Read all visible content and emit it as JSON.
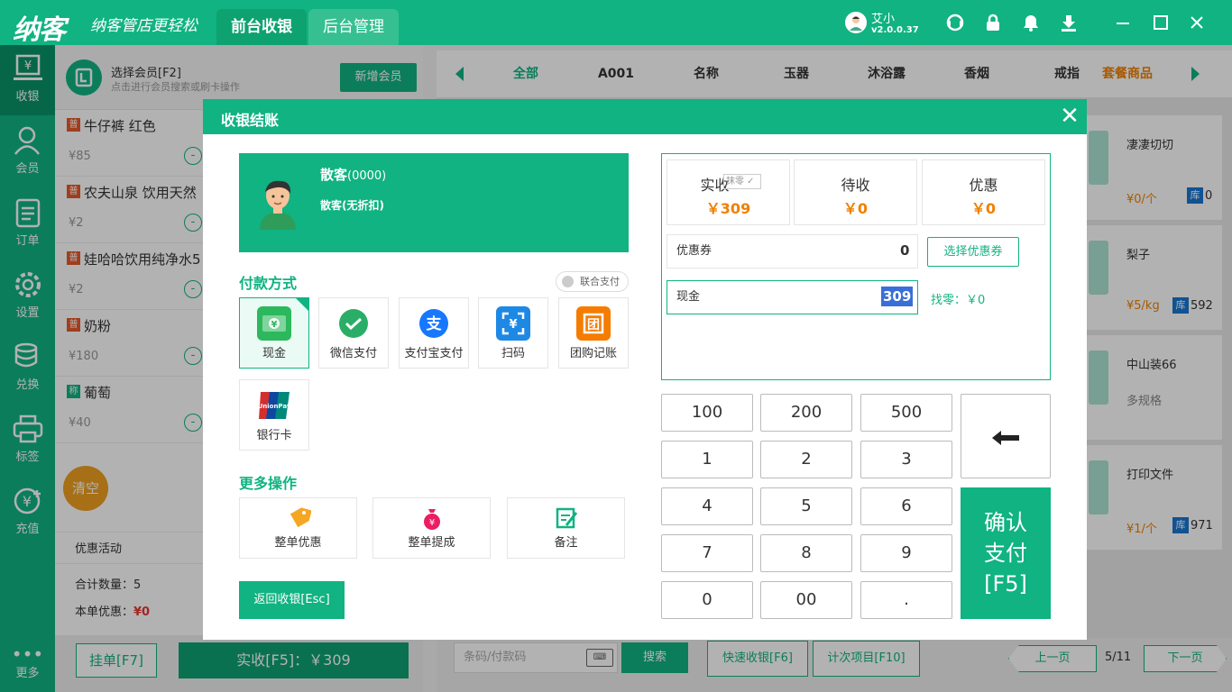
{
  "app": {
    "logo": "纳客",
    "slogan": "纳客管店更轻松",
    "tabs": [
      {
        "label": "前台收银"
      },
      {
        "label": "后台管理"
      }
    ],
    "user": {
      "name": "艾小",
      "version": "v2.0.0.37"
    }
  },
  "sidebar": {
    "items": [
      {
        "label": "收银",
        "icon": "cashier-icon"
      },
      {
        "label": "会员",
        "icon": "member-icon"
      },
      {
        "label": "订单",
        "icon": "order-icon"
      },
      {
        "label": "设置",
        "icon": "gear-icon"
      },
      {
        "label": "兑换",
        "icon": "exchange-icon"
      },
      {
        "label": "标签",
        "icon": "printer-icon"
      },
      {
        "label": "充值",
        "icon": "recharge-icon"
      },
      {
        "label": "更多",
        "icon": "more-icon"
      }
    ]
  },
  "member": {
    "title": "选择会员[F2]",
    "subtitle": "点击进行会员搜索或刷卡操作",
    "add_label": "新增会员"
  },
  "cart": {
    "items": [
      {
        "tag": "普",
        "name": "牛仔裤 红色",
        "price": "¥85"
      },
      {
        "tag": "普",
        "name": "农夫山泉 饮用天然",
        "price": "¥2"
      },
      {
        "tag": "普",
        "name": "娃哈哈饮用纯净水5",
        "price": "¥2"
      },
      {
        "tag": "普",
        "name": "奶粉",
        "price": "¥180"
      },
      {
        "tag": "称",
        "name": "葡萄",
        "price": "¥40"
      }
    ],
    "minus": "-",
    "clear_label": "清空",
    "promo_label": "优惠活动",
    "total_qty": "合计数量：5",
    "order_disc_label": "本单优惠：",
    "order_disc_value": "¥0",
    "hold_label": "挂单[F7]",
    "pay_label": "实收[F5]：￥309"
  },
  "categories": {
    "items": [
      "全部",
      "A001",
      "名称",
      "玉器",
      "沐浴露",
      "香烟",
      "戒指"
    ],
    "combo": "套餐商品"
  },
  "products": [
    {
      "name": "凄凄切切",
      "price": "¥0/个",
      "stock_tag": "库",
      "stock": "0"
    },
    {
      "name": "梨子",
      "price": "¥5/kg",
      "stock_tag": "库",
      "stock": "592"
    },
    {
      "name": "中山装66",
      "price": "多规格",
      "stock_tag": "",
      "stock": ""
    },
    {
      "name": "打印文件",
      "price": "¥1/个",
      "stock_tag": "库",
      "stock": "971"
    }
  ],
  "footer": {
    "search_placeholder": "条码/付款码",
    "kbd": "⌨",
    "search_label": "搜索",
    "quick_label": "快速收银[F6]",
    "count_label": "计次项目[F10]",
    "prev_label": "上一页",
    "page": "5/11",
    "next_label": "下一页"
  },
  "modal": {
    "title": "收银结账",
    "close": "✕",
    "customer": {
      "name": "散客",
      "code": "(0000)",
      "level": "散客(无折扣)"
    },
    "pay_title": "付款方式",
    "joint_label": "联合支付",
    "methods": [
      {
        "label": "现金",
        "icon": "cash-icon",
        "glyph": "¥",
        "color": "#2cb85c"
      },
      {
        "label": "微信支付",
        "icon": "wechat-icon",
        "glyph": "✓",
        "color": "#2aae67"
      },
      {
        "label": "支付宝支付",
        "icon": "alipay-icon",
        "glyph": "支",
        "color": "#1677ff"
      },
      {
        "label": "扫码",
        "icon": "scan-icon",
        "glyph": "¥",
        "color": "#1e88e5"
      },
      {
        "label": "团购记账",
        "icon": "groupbuy-icon",
        "glyph": "团",
        "color": "#f57c00"
      },
      {
        "label": "银行卡",
        "icon": "unionpay-icon",
        "glyph": "UP",
        "color": "#d32f2f"
      }
    ],
    "more_title": "更多操作",
    "more_ops": [
      {
        "label": "整单优惠",
        "icon": "discount-tag-icon",
        "glyph": "¥",
        "color": "#f5a623"
      },
      {
        "label": "整单提成",
        "icon": "commission-bag-icon",
        "glyph": "¥",
        "color": "#e91e63"
      },
      {
        "label": "备注",
        "icon": "note-edit-icon",
        "glyph": "✎",
        "color": "#10b381"
      }
    ],
    "back_label": "返回收银[Esc]",
    "summary": [
      {
        "label": "实收",
        "value": "￥309"
      },
      {
        "label": "待收",
        "value": "￥0"
      },
      {
        "label": "优惠",
        "value": "￥0"
      }
    ],
    "round_label": "抹零",
    "coupon_label": "优惠券",
    "coupon_value": "0",
    "coupon_btn": "选择优惠券",
    "cash_label": "现金",
    "cash_value": "309",
    "change": "找零：￥0",
    "keys": [
      "100",
      "200",
      "500",
      "1",
      "2",
      "3",
      "4",
      "5",
      "6",
      "7",
      "8",
      "9",
      "0",
      "00",
      "."
    ],
    "backspace": "⬅",
    "confirm": "确认\n支付\n[F5]"
  }
}
